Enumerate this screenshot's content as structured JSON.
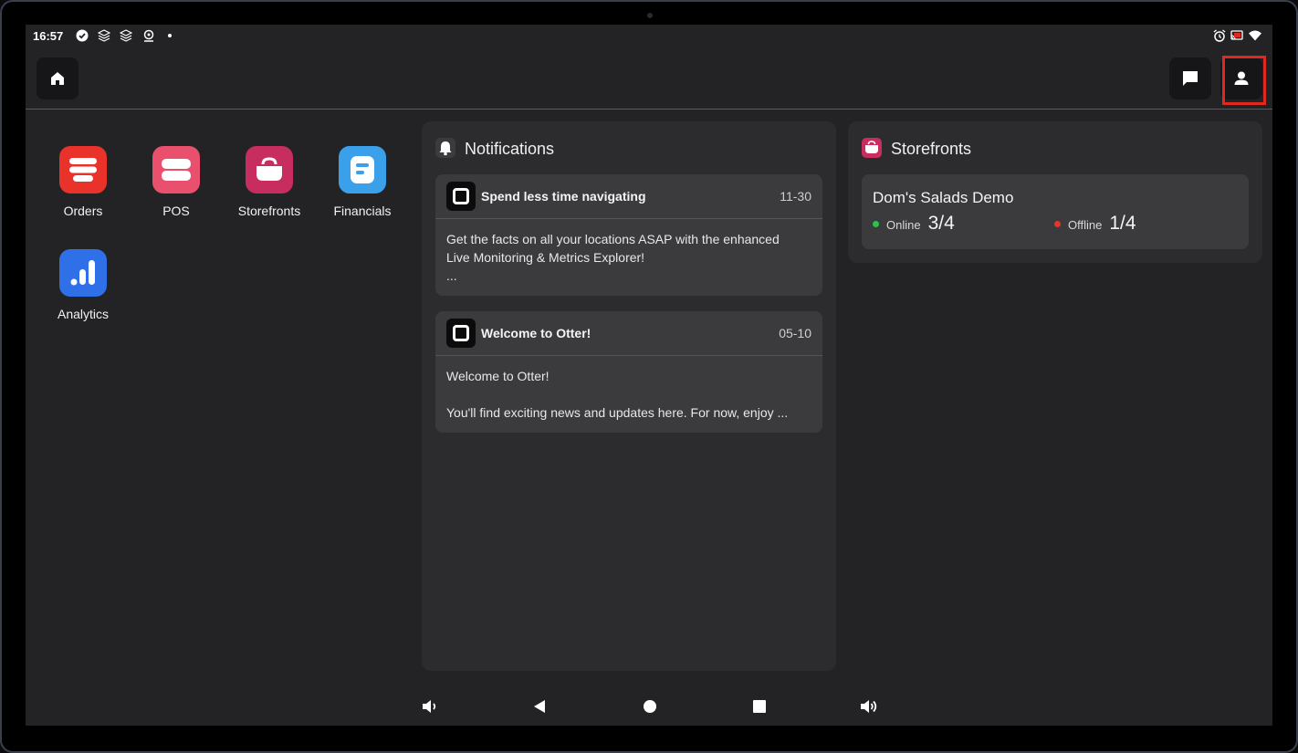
{
  "status_bar": {
    "time": "16:57",
    "left_icons": [
      "check-circle-icon",
      "layers-icon",
      "layers-icon",
      "location-icon",
      "dot-icon"
    ],
    "right_icons": [
      "alarm-icon",
      "cast-icon",
      "wifi-icon"
    ]
  },
  "top_bar": {
    "left_button": "home-icon",
    "right_buttons": [
      "chat-icon",
      "profile-icon"
    ],
    "highlight_color": "#e0281f"
  },
  "apps": [
    {
      "label": "Orders",
      "icon": "orders-icon",
      "color": "#e8322a"
    },
    {
      "label": "POS",
      "icon": "pos-icon",
      "color": "#e8506e"
    },
    {
      "label": "Storefronts",
      "icon": "storefront-icon",
      "color": "#c72d5e"
    },
    {
      "label": "Financials",
      "icon": "financials-icon",
      "color": "#3aa0ea"
    },
    {
      "label": "Analytics",
      "icon": "analytics-icon",
      "color": "#2f6fe8"
    }
  ],
  "notifications": {
    "title": "Notifications",
    "items": [
      {
        "title": "Spend less time navigating",
        "date": "11-30",
        "body_line1": "Get the facts on all your locations ASAP with the enhanced",
        "body_line2": "Live Monitoring & Metrics Explorer!",
        "body_line3": "..."
      },
      {
        "title": "Welcome to Otter!",
        "date": "05-10",
        "body_line1": "Welcome to Otter!",
        "body_line2": "",
        "body_line3": "You'll find exciting news and updates here. For now, enjoy ..."
      }
    ]
  },
  "storefronts": {
    "title": "Storefronts",
    "store_name": "Dom's Salads Demo",
    "online_label": "Online",
    "online_value": "3/4",
    "online_color": "#2fbf4f",
    "offline_label": "Offline",
    "offline_value": "1/4",
    "offline_color": "#e8322a"
  },
  "nav_bar": [
    "volume-down-icon",
    "back-icon",
    "home-circle-icon",
    "recents-icon",
    "volume-up-icon"
  ]
}
